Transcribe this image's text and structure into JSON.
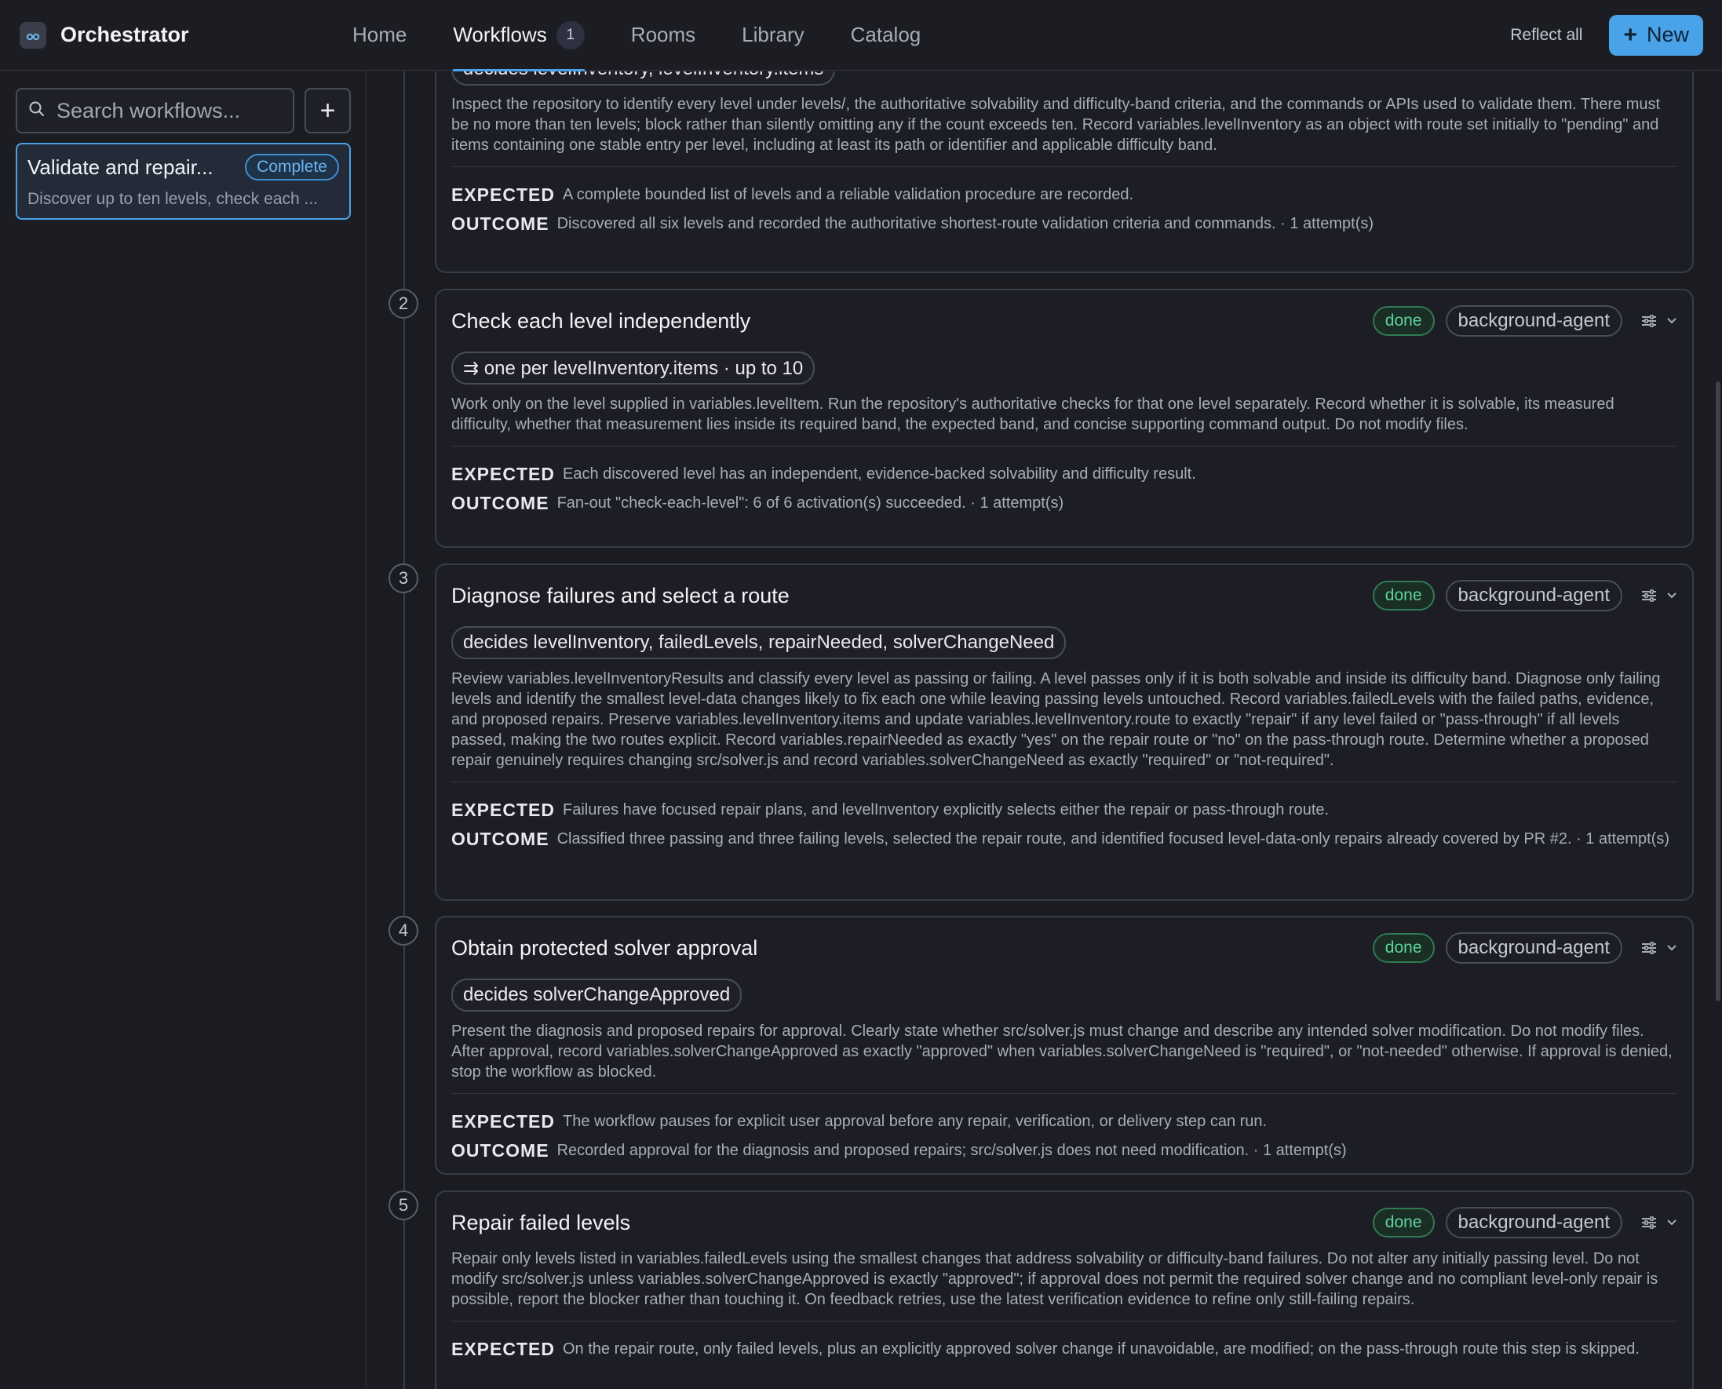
{
  "app": {
    "title": "Orchestrator"
  },
  "nav": {
    "items": [
      {
        "label": "Home"
      },
      {
        "label": "Workflows",
        "count": "1"
      },
      {
        "label": "Rooms"
      },
      {
        "label": "Library"
      },
      {
        "label": "Catalog"
      }
    ],
    "reflect_label": "Reflect all",
    "new_label": "New"
  },
  "sidebar": {
    "search_placeholder": "Search workflows...",
    "workflow": {
      "title": "Validate and repair...",
      "status": "Complete",
      "description": "Discover up to ten levels, check each ..."
    }
  },
  "colors": {
    "accent": "#4aa3e8",
    "done": "#5ed39a",
    "background": "#1b1c22"
  },
  "labels": {
    "expected": "EXPECTED",
    "outcome": "OUTCOME"
  },
  "steps": [
    {
      "decides": "decides levelInventory, levelInventory.items",
      "description": "Inspect the repository to identify every level under levels/, the authoritative solvability and difficulty-band criteria, and the commands or APIs used to validate them. There must be no more than ten levels; block rather than silently omitting any if the count exceeds ten. Record variables.levelInventory as an object with route set initially to \"pending\" and items containing one stable entry per level, including at least its path or identifier and applicable difficulty band.",
      "expected": "A complete bounded list of levels and a reliable validation procedure are recorded.",
      "outcome": "Discovered all six levels and recorded the authoritative shortest-route validation criteria and commands. · 1 attempt(s)"
    },
    {
      "number": "2",
      "title": "Check each level independently",
      "status": "done",
      "agent": "background-agent",
      "decides": "⇉ one per levelInventory.items · up to 10",
      "description": "Work only on the level supplied in variables.levelItem. Run the repository's authoritative checks for that one level separately. Record whether it is solvable, its measured difficulty, whether that measurement lies inside its required band, the expected band, and concise supporting command output. Do not modify files.",
      "expected": "Each discovered level has an independent, evidence-backed solvability and difficulty result.",
      "outcome": "Fan-out \"check-each-level\": 6 of 6 activation(s) succeeded. · 1 attempt(s)"
    },
    {
      "number": "3",
      "title": "Diagnose failures and select a route",
      "status": "done",
      "agent": "background-agent",
      "decides": "decides levelInventory, failedLevels, repairNeeded, solverChangeNeed",
      "description": "Review variables.levelInventoryResults and classify every level as passing or failing. A level passes only if it is both solvable and inside its difficulty band. Diagnose only failing levels and identify the smallest level-data changes likely to fix each one while leaving passing levels untouched. Record variables.failedLevels with the failed paths, evidence, and proposed repairs. Preserve variables.levelInventory.items and update variables.levelInventory.route to exactly \"repair\" if any level failed or \"pass-through\" if all levels passed, making the two routes explicit. Record variables.repairNeeded as exactly \"yes\" on the repair route or \"no\" on the pass-through route. Determine whether a proposed repair genuinely requires changing src/solver.js and record variables.solverChangeNeed as exactly \"required\" or \"not-required\".",
      "expected": "Failures have focused repair plans, and levelInventory explicitly selects either the repair or pass-through route.",
      "outcome": "Classified three passing and three failing levels, selected the repair route, and identified focused level-data-only repairs already covered by PR #2. · 1 attempt(s)"
    },
    {
      "number": "4",
      "title": "Obtain protected solver approval",
      "status": "done",
      "agent": "background-agent",
      "decides": "decides solverChangeApproved",
      "description": "Present the diagnosis and proposed repairs for approval. Clearly state whether src/solver.js must change and describe any intended solver modification. Do not modify files. After approval, record variables.solverChangeApproved as exactly \"approved\" when variables.solverChangeNeed is \"required\", or \"not-needed\" otherwise. If approval is denied, stop the workflow as blocked.",
      "expected": "The workflow pauses for explicit user approval before any repair, verification, or delivery step can run.",
      "outcome": "Recorded approval for the diagnosis and proposed repairs; src/solver.js does not need modification. · 1 attempt(s)"
    },
    {
      "number": "5",
      "title": "Repair failed levels",
      "status": "done",
      "agent": "background-agent",
      "description": "Repair only levels listed in variables.failedLevels using the smallest changes that address solvability or difficulty-band failures. Do not alter any initially passing level. Do not modify src/solver.js unless variables.solverChangeApproved is exactly \"approved\"; if approval does not permit the required solver change and no compliant level-only repair is possible, report the blocker rather than touching it. On feedback retries, use the latest verification evidence to refine only still-failing repairs.",
      "expected": "On the repair route, only failed levels, plus an explicitly approved solver change if unavoidable, are modified; on the pass-through route this step is skipped."
    }
  ]
}
